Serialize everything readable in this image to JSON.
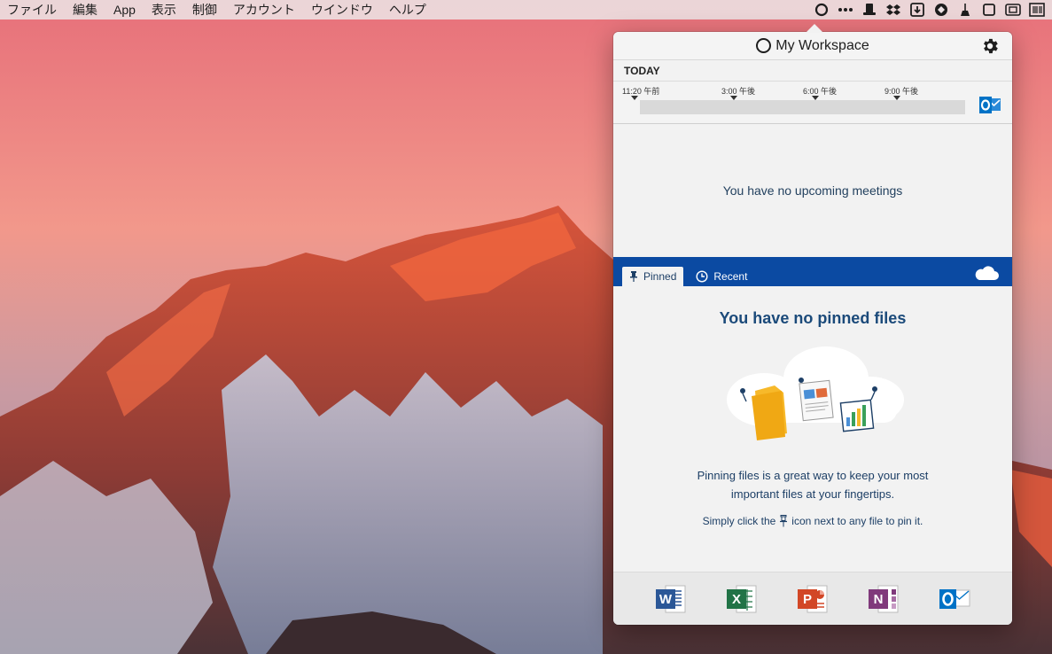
{
  "menubar": {
    "items": [
      "ファイル",
      "編集",
      "App",
      "表示",
      "制御",
      "アカウント",
      "ウインドウ",
      "ヘルプ"
    ],
    "tray_icons": [
      "workspace-ring-icon",
      "more-icon",
      "top-hat-icon",
      "dropbox-icon",
      "download-icon",
      "vpn-icon",
      "broom-icon",
      "window-icon",
      "screenshot-icon",
      "barcode-icon"
    ]
  },
  "popover": {
    "title": "My Workspace",
    "settings_icon": "gear-icon",
    "calendar": {
      "day_label": "TODAY",
      "ticks": [
        "11:20 午前",
        "3:00 午後",
        "6:00 午後",
        "9:00 午後"
      ],
      "empty_message": "You have no upcoming meetings"
    },
    "files": {
      "tabs": {
        "pinned": "Pinned",
        "recent": "Recent"
      },
      "active_tab": "pinned",
      "empty_title": "You have no pinned files",
      "description_line1": "Pinning files is a great way to keep your most",
      "description_line2": "important files at your fingertips.",
      "hint_before": "Simply click the",
      "hint_after": "icon next to any file to pin it."
    },
    "apps": [
      "word-icon",
      "excel-icon",
      "powerpoint-icon",
      "onenote-icon",
      "outlook-icon"
    ]
  },
  "colors": {
    "accent_blue": "#0b4aa2",
    "text_navy": "#1b4a7a",
    "word": "#2b5797",
    "excel": "#217346",
    "powerpoint": "#d24726",
    "onenote": "#80397b",
    "outlook": "#0072c6"
  }
}
